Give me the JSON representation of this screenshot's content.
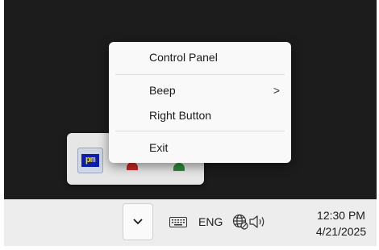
{
  "context_menu": {
    "items": [
      {
        "label": "Control Panel",
        "has_submenu": false
      },
      {
        "label": "Beep",
        "has_submenu": true,
        "submenu_arrow": ">"
      },
      {
        "label": "Right Button",
        "has_submenu": false
      },
      {
        "label": "Exit",
        "has_submenu": false
      }
    ]
  },
  "tray_overflow": {
    "icons": [
      {
        "name": "pm-app-icon",
        "text": "pm"
      },
      {
        "name": "red-app-icon"
      },
      {
        "name": "green-app-icon"
      }
    ]
  },
  "taskbar": {
    "language": "ENG",
    "time": "12:30 PM",
    "date": "4/21/2025"
  }
}
